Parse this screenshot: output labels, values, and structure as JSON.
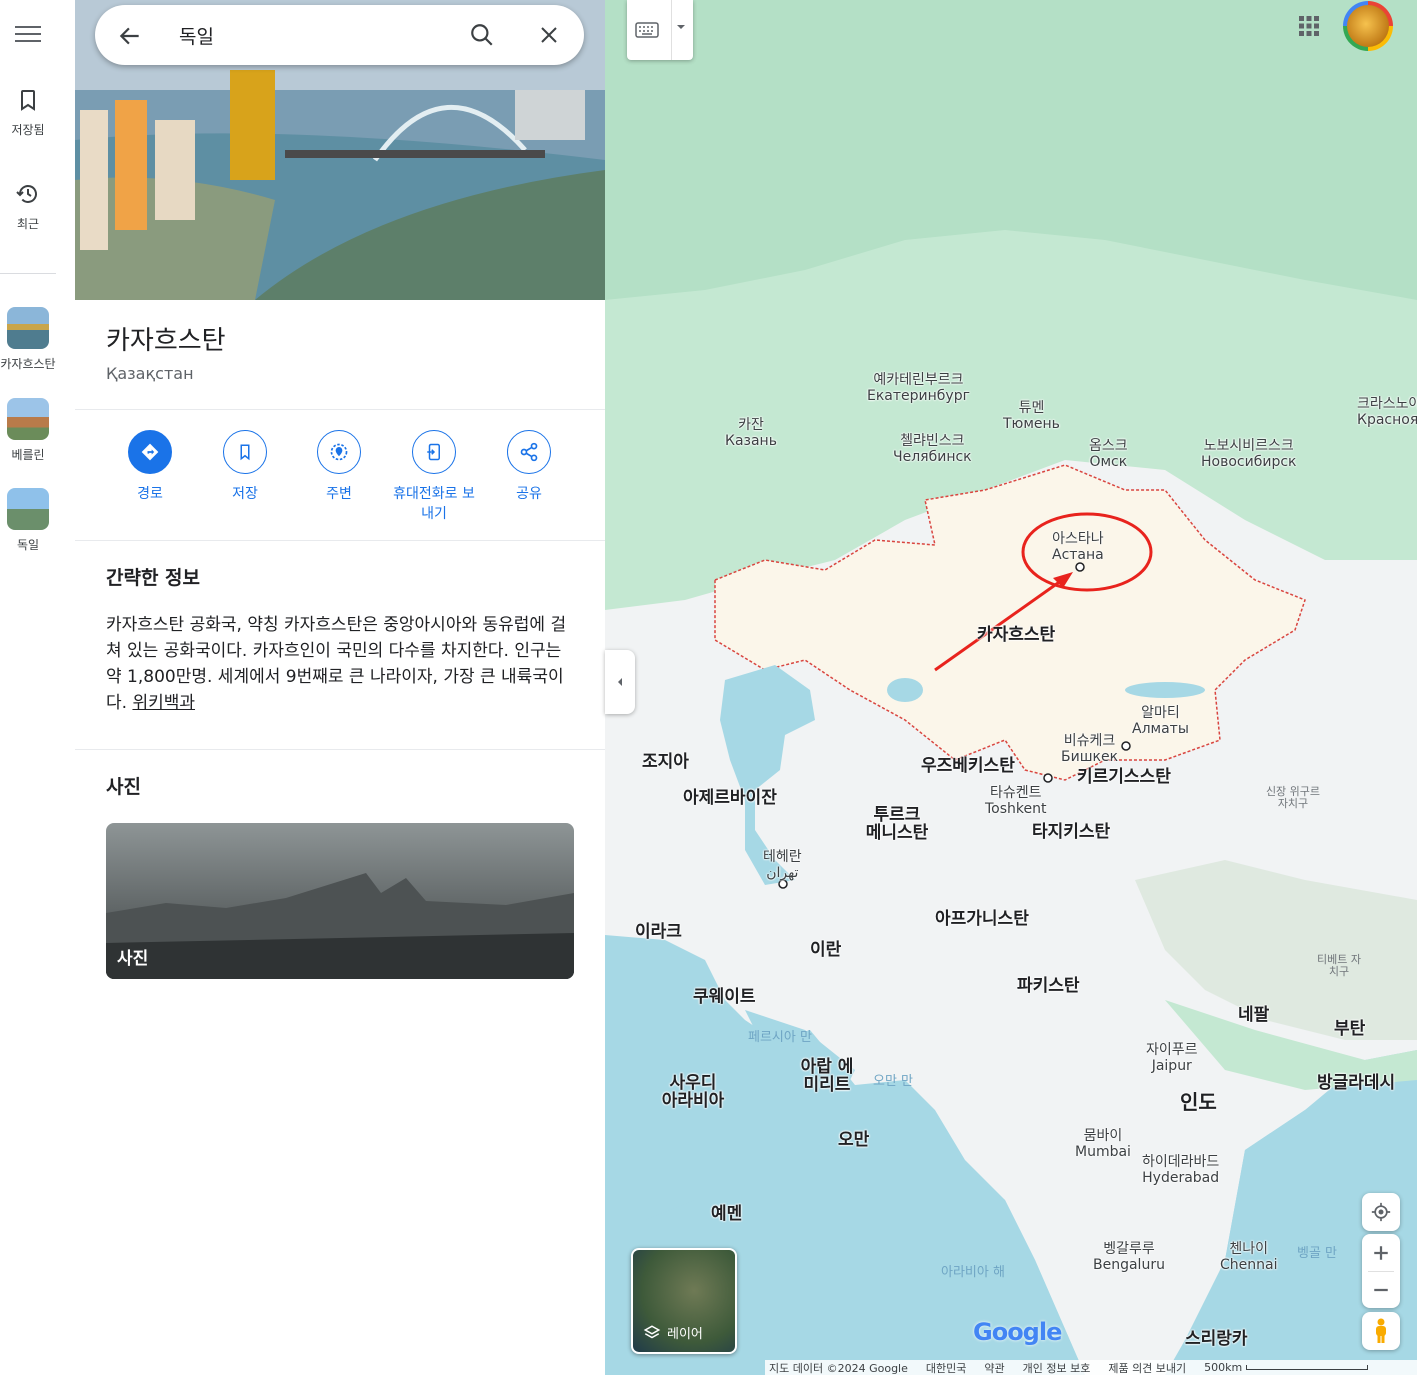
{
  "rail": {
    "saved_label": "저장됨",
    "recent_label": "최근",
    "history": [
      {
        "label": "카자흐스탄"
      },
      {
        "label": "베를린"
      },
      {
        "label": "독일"
      }
    ]
  },
  "search": {
    "value": "독일"
  },
  "place": {
    "title": "카자흐스탄",
    "subtitle": "Қазақстан",
    "actions": [
      {
        "label": "경로",
        "icon": "directions-icon"
      },
      {
        "label": "저장",
        "icon": "bookmark-icon"
      },
      {
        "label": "주변",
        "icon": "nearby-icon"
      },
      {
        "label": "휴대전화로 보내기",
        "icon": "send-to-phone-icon"
      },
      {
        "label": "공유",
        "icon": "share-icon"
      }
    ],
    "summary_heading": "간략한 정보",
    "summary_text": "카자흐스탄 공화국, 약칭 카자흐스탄은 중앙아시아와 동유럽에 걸쳐 있는 공화국이다. 카자흐인이 국민의 다수를 차지한다. 인구는 약 1,800만명. 세계에서 9번째로 큰 나라이자, 가장 큰 내륙국이다.",
    "summary_link": "위키백과",
    "photos_heading": "사진",
    "photo_label": "사진"
  },
  "map": {
    "cities": [
      {
        "ko": "예카테린부르크",
        "local": "Екатеринбург"
      },
      {
        "ko": "튜멘",
        "local": "Тюмень"
      },
      {
        "ko": "카잔",
        "local": "Казань"
      },
      {
        "ko": "첼랴빈스크",
        "local": "Челябинск"
      },
      {
        "ko": "옴스크",
        "local": "Омск"
      },
      {
        "ko": "노보시비르스크",
        "local": "Новосибирск"
      },
      {
        "ko": "크라스노야르스크",
        "local": "Красноя"
      },
      {
        "ko": "아스타나",
        "local": "Астана"
      },
      {
        "ko": "알마티",
        "local": "Алматы"
      },
      {
        "ko": "비슈케크",
        "local": "Бишкек"
      },
      {
        "ko": "타슈켄트",
        "local": "Toshkent"
      },
      {
        "ko": "테헤란",
        "local": "تهران"
      },
      {
        "ko": "자이푸르",
        "local": "Jaipur"
      },
      {
        "ko": "뭄바이",
        "local": "Mumbai"
      },
      {
        "ko": "하이데라바드",
        "local": "Hyderabad"
      },
      {
        "ko": "벵갈루루",
        "local": "Bengaluru"
      },
      {
        "ko": "첸나이",
        "local": "Chennai"
      }
    ],
    "countries": [
      "카자흐스탄",
      "조지아",
      "아제르바이잔",
      "우즈베키스탄",
      "키르기스스탄",
      "투르크 메니스탄",
      "타지키스탄",
      "아프가니스탄",
      "이라크",
      "이란",
      "쿠웨이트",
      "파키스탄",
      "사우디 아라비아",
      "아랍 에미리트",
      "오만",
      "예멘",
      "인도",
      "네팔",
      "부탄",
      "방글라데시",
      "스리랑카"
    ],
    "waters": [
      "페르시아 만",
      "오만 만",
      "아라비아 해",
      "벵골 만"
    ],
    "regions": [
      "신장 위구르 자치구",
      "티베트 자치구"
    ],
    "layer_label": "레이어",
    "google_logo": "Google",
    "footer": [
      "지도 데이터 ©2024 Google",
      "대한민국",
      "약관",
      "개인 정보 보호",
      "제품 의견 보내기"
    ],
    "scale": "500km",
    "colors": {
      "water": "#a6d8e5",
      "land": "#f1f3f4",
      "forest": "#bfe6cf",
      "highlight": "#fbf6ea",
      "border": "#d9453f",
      "annotation": "#e8231d",
      "accent": "#1a73e8"
    }
  }
}
